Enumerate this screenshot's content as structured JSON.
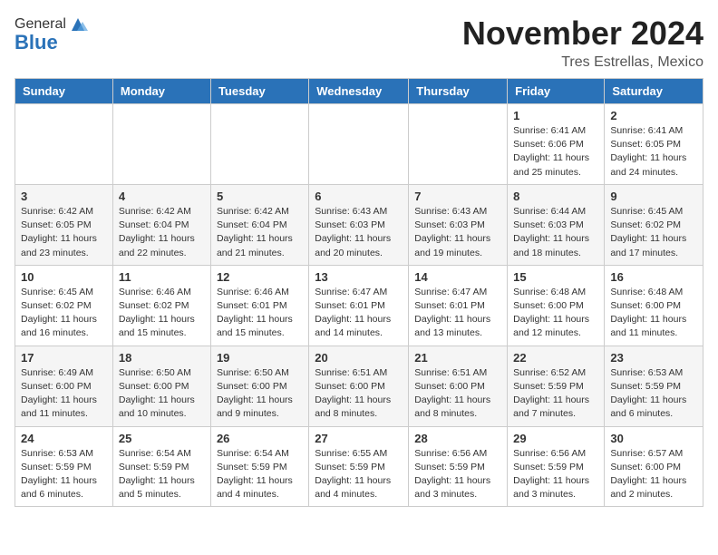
{
  "header": {
    "logo_general": "General",
    "logo_blue": "Blue",
    "month_title": "November 2024",
    "location": "Tres Estrellas, Mexico"
  },
  "days_of_week": [
    "Sunday",
    "Monday",
    "Tuesday",
    "Wednesday",
    "Thursday",
    "Friday",
    "Saturday"
  ],
  "weeks": [
    [
      {
        "day": "",
        "info": ""
      },
      {
        "day": "",
        "info": ""
      },
      {
        "day": "",
        "info": ""
      },
      {
        "day": "",
        "info": ""
      },
      {
        "day": "",
        "info": ""
      },
      {
        "day": "1",
        "info": "Sunrise: 6:41 AM\nSunset: 6:06 PM\nDaylight: 11 hours\nand 25 minutes."
      },
      {
        "day": "2",
        "info": "Sunrise: 6:41 AM\nSunset: 6:05 PM\nDaylight: 11 hours\nand 24 minutes."
      }
    ],
    [
      {
        "day": "3",
        "info": "Sunrise: 6:42 AM\nSunset: 6:05 PM\nDaylight: 11 hours\nand 23 minutes."
      },
      {
        "day": "4",
        "info": "Sunrise: 6:42 AM\nSunset: 6:04 PM\nDaylight: 11 hours\nand 22 minutes."
      },
      {
        "day": "5",
        "info": "Sunrise: 6:42 AM\nSunset: 6:04 PM\nDaylight: 11 hours\nand 21 minutes."
      },
      {
        "day": "6",
        "info": "Sunrise: 6:43 AM\nSunset: 6:03 PM\nDaylight: 11 hours\nand 20 minutes."
      },
      {
        "day": "7",
        "info": "Sunrise: 6:43 AM\nSunset: 6:03 PM\nDaylight: 11 hours\nand 19 minutes."
      },
      {
        "day": "8",
        "info": "Sunrise: 6:44 AM\nSunset: 6:03 PM\nDaylight: 11 hours\nand 18 minutes."
      },
      {
        "day": "9",
        "info": "Sunrise: 6:45 AM\nSunset: 6:02 PM\nDaylight: 11 hours\nand 17 minutes."
      }
    ],
    [
      {
        "day": "10",
        "info": "Sunrise: 6:45 AM\nSunset: 6:02 PM\nDaylight: 11 hours\nand 16 minutes."
      },
      {
        "day": "11",
        "info": "Sunrise: 6:46 AM\nSunset: 6:02 PM\nDaylight: 11 hours\nand 15 minutes."
      },
      {
        "day": "12",
        "info": "Sunrise: 6:46 AM\nSunset: 6:01 PM\nDaylight: 11 hours\nand 15 minutes."
      },
      {
        "day": "13",
        "info": "Sunrise: 6:47 AM\nSunset: 6:01 PM\nDaylight: 11 hours\nand 14 minutes."
      },
      {
        "day": "14",
        "info": "Sunrise: 6:47 AM\nSunset: 6:01 PM\nDaylight: 11 hours\nand 13 minutes."
      },
      {
        "day": "15",
        "info": "Sunrise: 6:48 AM\nSunset: 6:00 PM\nDaylight: 11 hours\nand 12 minutes."
      },
      {
        "day": "16",
        "info": "Sunrise: 6:48 AM\nSunset: 6:00 PM\nDaylight: 11 hours\nand 11 minutes."
      }
    ],
    [
      {
        "day": "17",
        "info": "Sunrise: 6:49 AM\nSunset: 6:00 PM\nDaylight: 11 hours\nand 11 minutes."
      },
      {
        "day": "18",
        "info": "Sunrise: 6:50 AM\nSunset: 6:00 PM\nDaylight: 11 hours\nand 10 minutes."
      },
      {
        "day": "19",
        "info": "Sunrise: 6:50 AM\nSunset: 6:00 PM\nDaylight: 11 hours\nand 9 minutes."
      },
      {
        "day": "20",
        "info": "Sunrise: 6:51 AM\nSunset: 6:00 PM\nDaylight: 11 hours\nand 8 minutes."
      },
      {
        "day": "21",
        "info": "Sunrise: 6:51 AM\nSunset: 6:00 PM\nDaylight: 11 hours\nand 8 minutes."
      },
      {
        "day": "22",
        "info": "Sunrise: 6:52 AM\nSunset: 5:59 PM\nDaylight: 11 hours\nand 7 minutes."
      },
      {
        "day": "23",
        "info": "Sunrise: 6:53 AM\nSunset: 5:59 PM\nDaylight: 11 hours\nand 6 minutes."
      }
    ],
    [
      {
        "day": "24",
        "info": "Sunrise: 6:53 AM\nSunset: 5:59 PM\nDaylight: 11 hours\nand 6 minutes."
      },
      {
        "day": "25",
        "info": "Sunrise: 6:54 AM\nSunset: 5:59 PM\nDaylight: 11 hours\nand 5 minutes."
      },
      {
        "day": "26",
        "info": "Sunrise: 6:54 AM\nSunset: 5:59 PM\nDaylight: 11 hours\nand 4 minutes."
      },
      {
        "day": "27",
        "info": "Sunrise: 6:55 AM\nSunset: 5:59 PM\nDaylight: 11 hours\nand 4 minutes."
      },
      {
        "day": "28",
        "info": "Sunrise: 6:56 AM\nSunset: 5:59 PM\nDaylight: 11 hours\nand 3 minutes."
      },
      {
        "day": "29",
        "info": "Sunrise: 6:56 AM\nSunset: 5:59 PM\nDaylight: 11 hours\nand 3 minutes."
      },
      {
        "day": "30",
        "info": "Sunrise: 6:57 AM\nSunset: 6:00 PM\nDaylight: 11 hours\nand 2 minutes."
      }
    ]
  ]
}
